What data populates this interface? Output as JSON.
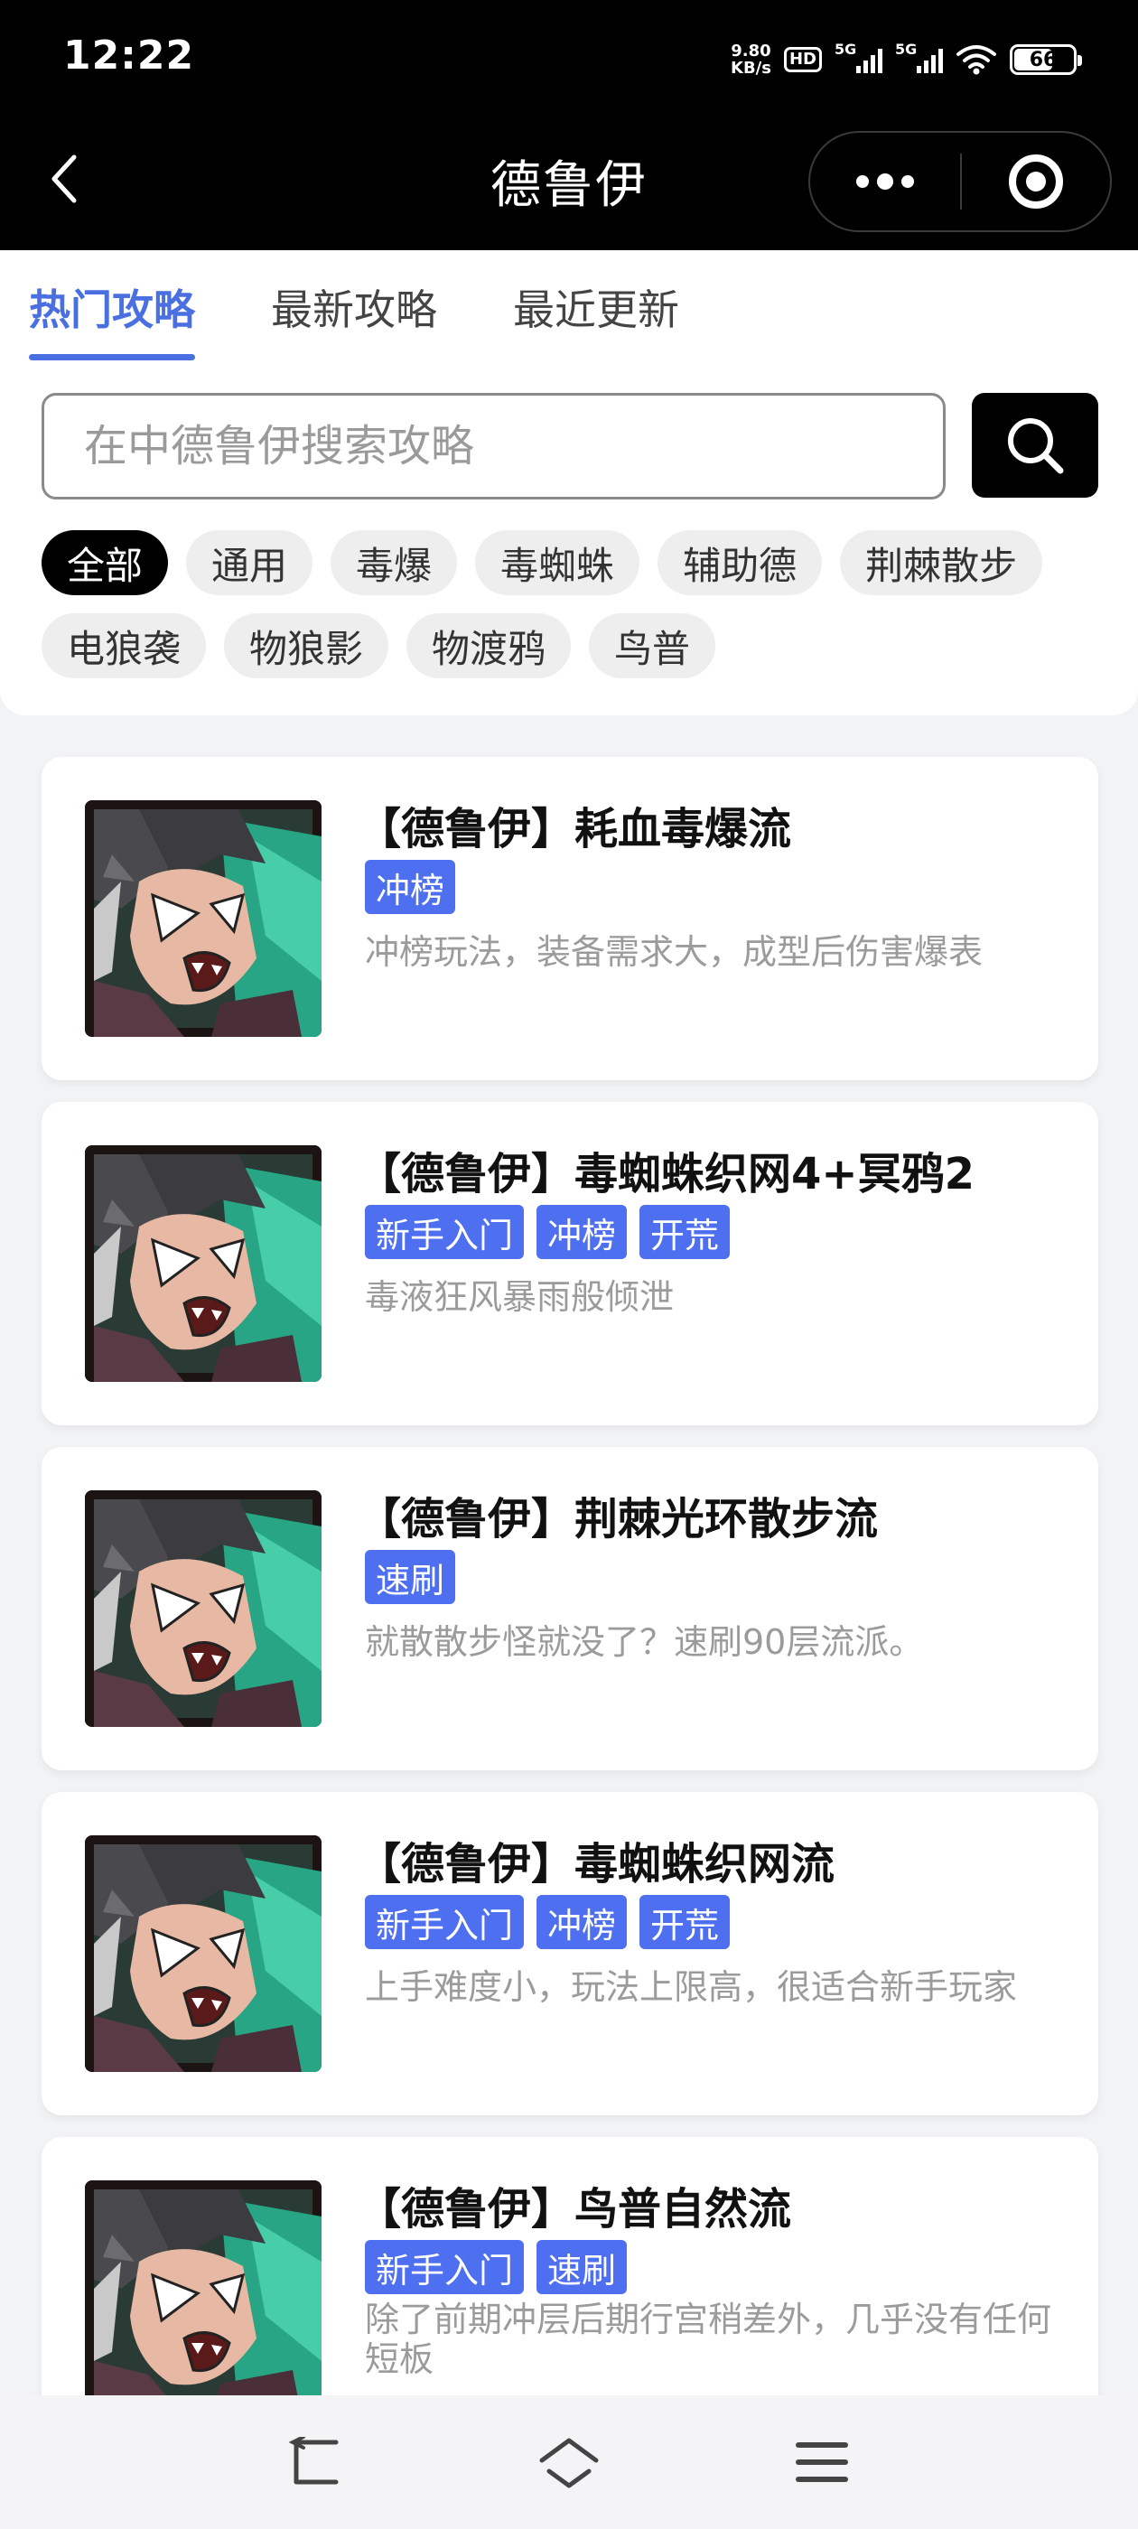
{
  "status_bar": {
    "time": "12:22",
    "net_speed_value": "9.80",
    "net_speed_unit": "KB/s",
    "hd_label": "HD",
    "sim1_label": "5G",
    "sim2_label": "5G",
    "battery": "66"
  },
  "header": {
    "title": "德鲁伊"
  },
  "tabs": [
    {
      "label": "热门攻略",
      "active": true
    },
    {
      "label": "最新攻略",
      "active": false
    },
    {
      "label": "最近更新",
      "active": false
    }
  ],
  "search": {
    "placeholder": "在中德鲁伊搜索攻略",
    "value": ""
  },
  "filters": [
    {
      "label": "全部",
      "active": true
    },
    {
      "label": "通用"
    },
    {
      "label": "毒爆"
    },
    {
      "label": "毒蜘蛛"
    },
    {
      "label": "辅助德"
    },
    {
      "label": "荆棘散步"
    },
    {
      "label": "电狼袭"
    },
    {
      "label": "物狼影"
    },
    {
      "label": "物渡鸦"
    },
    {
      "label": "鸟普"
    }
  ],
  "guides": [
    {
      "title": "【德鲁伊】耗血毒爆流",
      "tags": [
        "冲榜"
      ],
      "desc": "冲榜玩法，装备需求大，成型后伤害爆表"
    },
    {
      "title": "【德鲁伊】毒蜘蛛织网4+冥鸦2",
      "tags": [
        "新手入门",
        "冲榜",
        "开荒"
      ],
      "desc": "毒液狂风暴雨般倾泄"
    },
    {
      "title": "【德鲁伊】荆棘光环散步流",
      "tags": [
        "速刷"
      ],
      "desc": "就散散步怪就没了？速刷90层流派。"
    },
    {
      "title": "【德鲁伊】毒蜘蛛织网流",
      "tags": [
        "新手入门",
        "冲榜",
        "开荒"
      ],
      "desc": "上手难度小，玩法上限高，很适合新手玩家"
    },
    {
      "title": "【德鲁伊】鸟普自然流",
      "tags": [
        "新手入门",
        "速刷"
      ],
      "desc": "除了前期冲层后期行宫稍差外，几乎没有任何短板"
    }
  ],
  "colors": {
    "accent": "#4a6fe0",
    "tag_bg": "#4d6ff0",
    "header_bg": "#000000",
    "page_bg": "#f2f3f5"
  },
  "icons": {
    "back": "chevron-left-icon",
    "more": "more-dots-icon",
    "close": "target-close-icon",
    "search": "search-icon",
    "nav_back": "nav-back-icon",
    "nav_home": "nav-home-icon",
    "nav_menu": "nav-menu-icon"
  }
}
